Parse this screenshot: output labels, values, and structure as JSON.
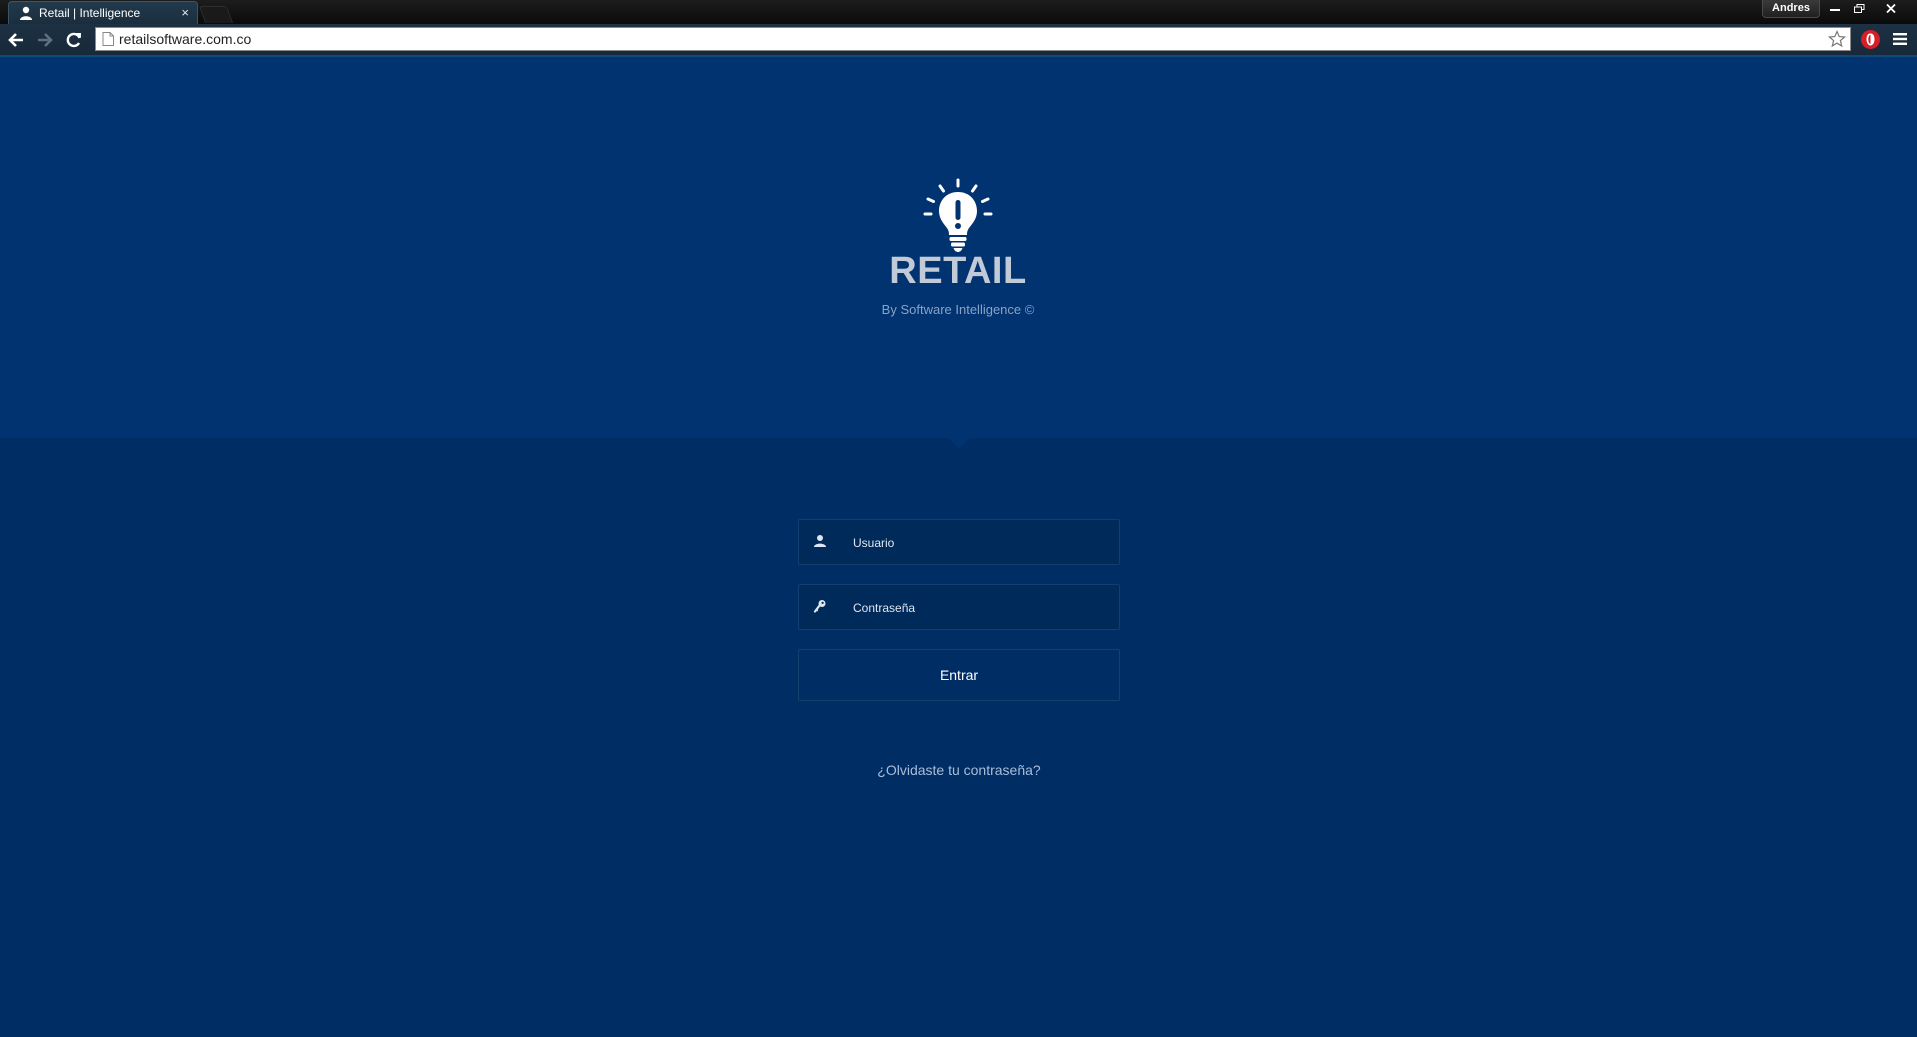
{
  "browser": {
    "tab_title": "Retail | Intelligence",
    "tab_close": "×",
    "profile_name": "Andres",
    "url": "retailsoftware.com.co",
    "window_minimize": "–",
    "window_close": "×"
  },
  "header": {
    "brand": "RETAIL",
    "byline": "By Software Intelligence ©"
  },
  "login": {
    "username_placeholder": "Usuario",
    "password_placeholder": "Contraseña",
    "submit_label": "Entrar",
    "forgot_link": "¿Olvidaste tu contraseña?"
  },
  "colors": {
    "hero_background": "#003370",
    "page_background": "#002e64",
    "field_background": "#002a5a",
    "brand_text": "#c2cad8"
  }
}
